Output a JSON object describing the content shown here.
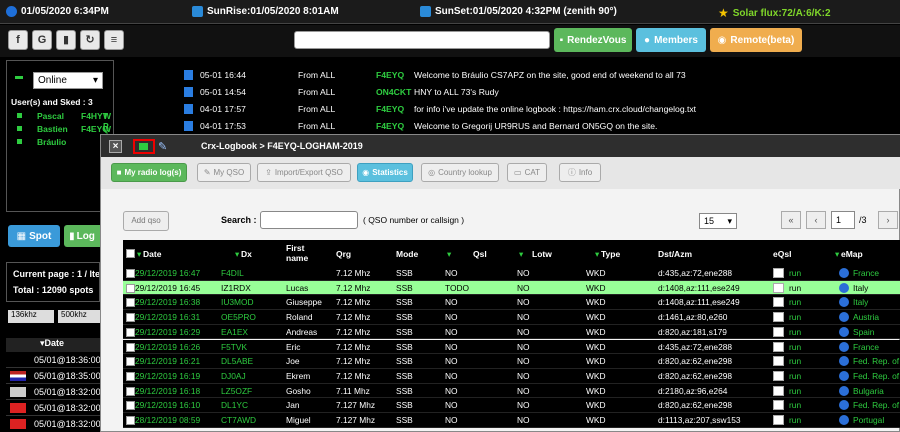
{
  "topbar": {
    "datetime": "01/05/2020 6:34PM",
    "sunrise": "SunRise:01/05/2020 8:01AM",
    "sunset": "SunSet:01/05/2020 4:32PM (zenith 90°)",
    "solar": "Solar flux:72/A:6/K:2"
  },
  "toolbar": {
    "btns": [
      "f",
      "G",
      "▮",
      "↻",
      "≡"
    ],
    "rendezvous": "RendezVous",
    "members": "Members",
    "remote": "Remote(beta)"
  },
  "sidebar": {
    "status": "Online",
    "users_label": "User(s) and Sked : 3",
    "users": [
      {
        "name": "Pascal",
        "call": "F4HYT",
        "flags": "W P"
      },
      {
        "name": "Bastien",
        "call": "F4EYQ",
        "flags": "W P"
      },
      {
        "name": "Bráulio",
        "call": "",
        "flags": ""
      }
    ]
  },
  "messages": [
    {
      "time": "05-01 16:44",
      "from": "From ALL",
      "call": "F4EYQ",
      "text": "Welcome to Bráulio CS7APZ on the site, good end of weekend to all 73"
    },
    {
      "time": "05-01 14:54",
      "from": "From ALL",
      "call": "ON4CKT",
      "text": "HNY to ALL 73's Rudy"
    },
    {
      "time": "04-01 17:57",
      "from": "From ALL",
      "call": "F4EYQ",
      "text": "for info i've update the online logbook : https://ham.crx.cloud/changelog.txt"
    },
    {
      "time": "04-01 17:53",
      "from": "From ALL",
      "call": "F4EYQ",
      "text": "Welcome to Gregorij UR9RUS and Bernard ON5GQ on the site."
    }
  ],
  "left": {
    "spot": "Spot",
    "log": "Log",
    "current_page": "Current page : 1 / Ite",
    "total": "Total : 12090 spots",
    "f1": "136khz",
    "f2": "500khz",
    "date_hdr": "Date",
    "dates": [
      "05/01@18:36:00",
      "05/01@18:35:00",
      "05/01@18:32:00",
      "05/01@18:32:00",
      "05/01@18:32:00"
    ]
  },
  "modal": {
    "title": "Crx-Logbook > F4EYQ-LOGHAM-2019",
    "tabs": [
      "My radio log(s)",
      "My QSO",
      "Import/Export QSO",
      "Statistics",
      "Country lookup",
      "CAT",
      "Info"
    ],
    "add_qso": "Add qso",
    "search_label": "Search :",
    "search_hint": "( QSO number or callsign )",
    "page_size": "15",
    "page_num": "1",
    "page_total": "/3",
    "headers": [
      "Date",
      "Dx",
      "First name",
      "Qrg",
      "Mode",
      "Qsl",
      "Lotw",
      "Type",
      "Dst/Azm",
      "eQsl",
      "eMap"
    ],
    "rows": [
      [
        "29/12/2019 16:47",
        "F4DIL",
        "",
        "7.12 Mhz",
        "SSB",
        "NO",
        "NO",
        "WKD",
        "d:435,az:72,ene288",
        "run",
        "France"
      ],
      [
        "29/12/2019 16:45",
        "IZ1RDX",
        "Lucas",
        "7.12 Mhz",
        "SSB",
        "TODO",
        "NO",
        "WKD",
        "d:1408,az:111,ese249",
        "run",
        "Italy"
      ],
      [
        "29/12/2019 16:38",
        "IU3MOD",
        "Giuseppe",
        "7.12 Mhz",
        "SSB",
        "NO",
        "NO",
        "WKD",
        "d:1408,az:111,ese249",
        "run",
        "Italy"
      ],
      [
        "29/12/2019 16:31",
        "OE5PRO",
        "Roland",
        "7.12 Mhz",
        "SSB",
        "NO",
        "NO",
        "WKD",
        "d:1461,az:80,e260",
        "run",
        "Austria"
      ],
      [
        "29/12/2019 16:29",
        "EA1EX",
        "Andreas",
        "7.12 Mhz",
        "SSB",
        "NO",
        "NO",
        "WKD",
        "d:820,az:181,s179",
        "run",
        "Spain"
      ],
      [
        "29/12/2019 16:26",
        "F5TVK",
        "Eric",
        "7.12 Mhz",
        "SSB",
        "NO",
        "NO",
        "WKD",
        "d:435,az:72,ene288",
        "run",
        "France"
      ],
      [
        "29/12/2019 16:21",
        "DL5ABE",
        "Joe",
        "7.12 Mhz",
        "SSB",
        "NO",
        "NO",
        "WKD",
        "d:820,az:62,ene298",
        "run",
        "Fed. Rep. of"
      ],
      [
        "29/12/2019 16:19",
        "DJ0AJ",
        "Ekrem",
        "7.12 Mhz",
        "SSB",
        "NO",
        "NO",
        "WKD",
        "d:820,az:62,ene298",
        "run",
        "Fed. Rep. of"
      ],
      [
        "29/12/2019 16:18",
        "LZ5OZF",
        "Gosho",
        "7.11 Mhz",
        "SSB",
        "NO",
        "NO",
        "WKD",
        "d:2180,az:96,e264",
        "run",
        "Bulgaria"
      ],
      [
        "29/12/2019 16:10",
        "DL1YC",
        "Jan",
        "7.127 Mhz",
        "SSB",
        "NO",
        "NO",
        "WKD",
        "d:820,az:62,ene298",
        "run",
        "Fed. Rep. of"
      ],
      [
        "28/12/2019 08:59",
        "CT7AWD",
        "Miguel",
        "7.127 Mhz",
        "SSB",
        "NO",
        "NO",
        "WKD",
        "d:1113,az:207,ssw153",
        "run",
        "Portugal"
      ]
    ]
  }
}
